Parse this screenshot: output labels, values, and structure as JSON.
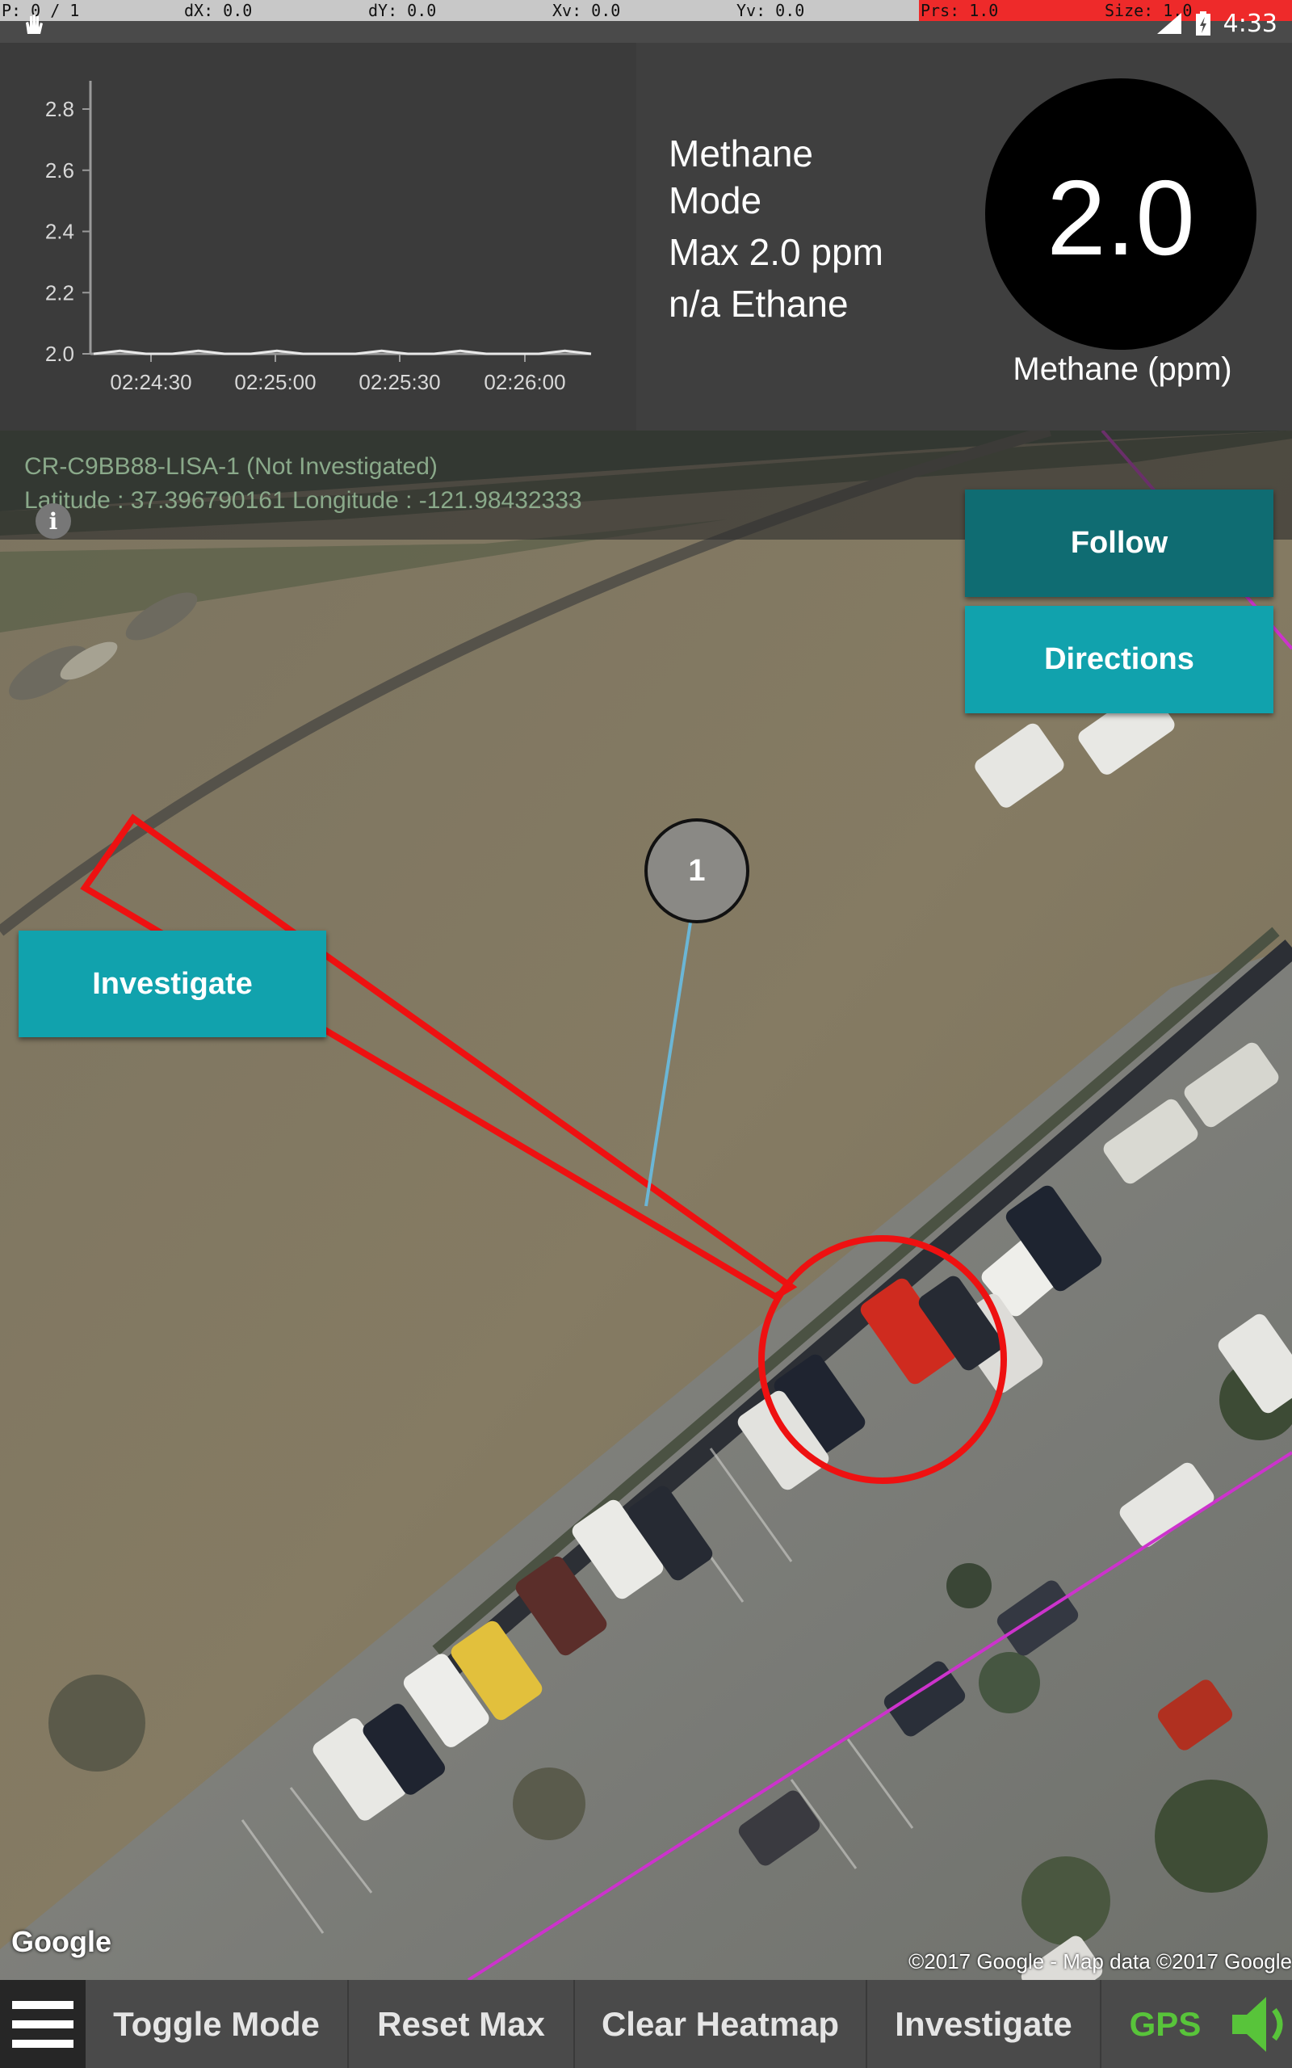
{
  "device_bar": {
    "p": "P: 0 / 1",
    "dx": "dX: 0.0",
    "dy": "dY: 0.0",
    "xv": "Xv: 0.0",
    "yv": "Yv: 0.0",
    "prs": "Prs: 1.0",
    "size": "Size: 1.0"
  },
  "system": {
    "time": "4:33"
  },
  "chart_data": {
    "type": "line",
    "y_ticks": [
      "2.8",
      "2.6",
      "2.4",
      "2.2",
      "2.0"
    ],
    "x_ticks": [
      "02:24:30",
      "02:25:00",
      "02:25:30",
      "02:26:00"
    ],
    "ylim": [
      2.0,
      2.8
    ],
    "series": [
      {
        "values": [
          2.0,
          2.01,
          2.0,
          2.0,
          2.01,
          2.0,
          2.0,
          2.01,
          2.0,
          2.0,
          2.0,
          2.01,
          2.0,
          2.0,
          2.01,
          2.0,
          2.0,
          2.0,
          2.01,
          2.0
        ]
      }
    ]
  },
  "info": {
    "mode_line1": "Methane",
    "mode_line2": "Mode",
    "max": "Max 2.0 ppm",
    "ethane": "n/a Ethane"
  },
  "gauge": {
    "value": "2.0",
    "label": "Methane (ppm)"
  },
  "map": {
    "lisa_id": "CR-C9BB88-LISA-1  (Not Investigated)",
    "coords": "Latitude : 37.396790161  Longitude  :  -121.98432333",
    "marker_label": "1",
    "follow": "Follow",
    "directions": "Directions",
    "investigate": "Investigate",
    "google_logo": "Google",
    "attribution": "©2017 Google - Map data ©2017 Google"
  },
  "bottom_bar": {
    "toggle_mode": "Toggle Mode",
    "reset_max": "Reset Max",
    "clear_heatmap": "Clear Heatmap",
    "investigate": "Investigate",
    "gps": "GPS"
  },
  "colors": {
    "teal": "#11a2ad",
    "teal_dark": "#0f6c72",
    "gps_green": "#58c43a",
    "red": "#ee1111",
    "magenta": "#cc33cc"
  }
}
